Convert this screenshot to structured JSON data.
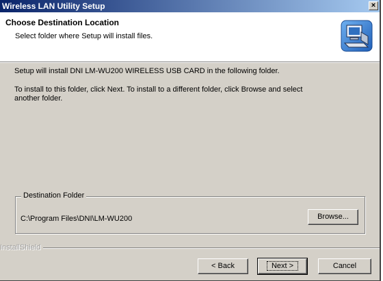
{
  "window": {
    "title": "Wireless LAN Utility Setup",
    "close_glyph": "×"
  },
  "header": {
    "heading": "Choose Destination Location",
    "subheading": "Select folder where Setup will install files.",
    "icon": "installer-computer-icon"
  },
  "body": {
    "line1": "Setup will install DNI LM-WU200 WIRELESS USB CARD in the following folder.",
    "line2": "To install to this folder, click Next. To install to a different folder, click Browse and select",
    "line3": "another folder."
  },
  "destination": {
    "legend": "Destination Folder",
    "path": "C:\\Program Files\\DNI\\LM-WU200",
    "browse_label": "Browse...",
    "browse_mnemonic": "r"
  },
  "footer": {
    "brand": "InstallShield",
    "back_label": "< Back",
    "next_label": "Next >",
    "cancel_label": "Cancel"
  },
  "colors": {
    "title_gradient_start": "#0a246a",
    "title_gradient_end": "#a6caf0",
    "dialog_face": "#d4d0c8"
  }
}
